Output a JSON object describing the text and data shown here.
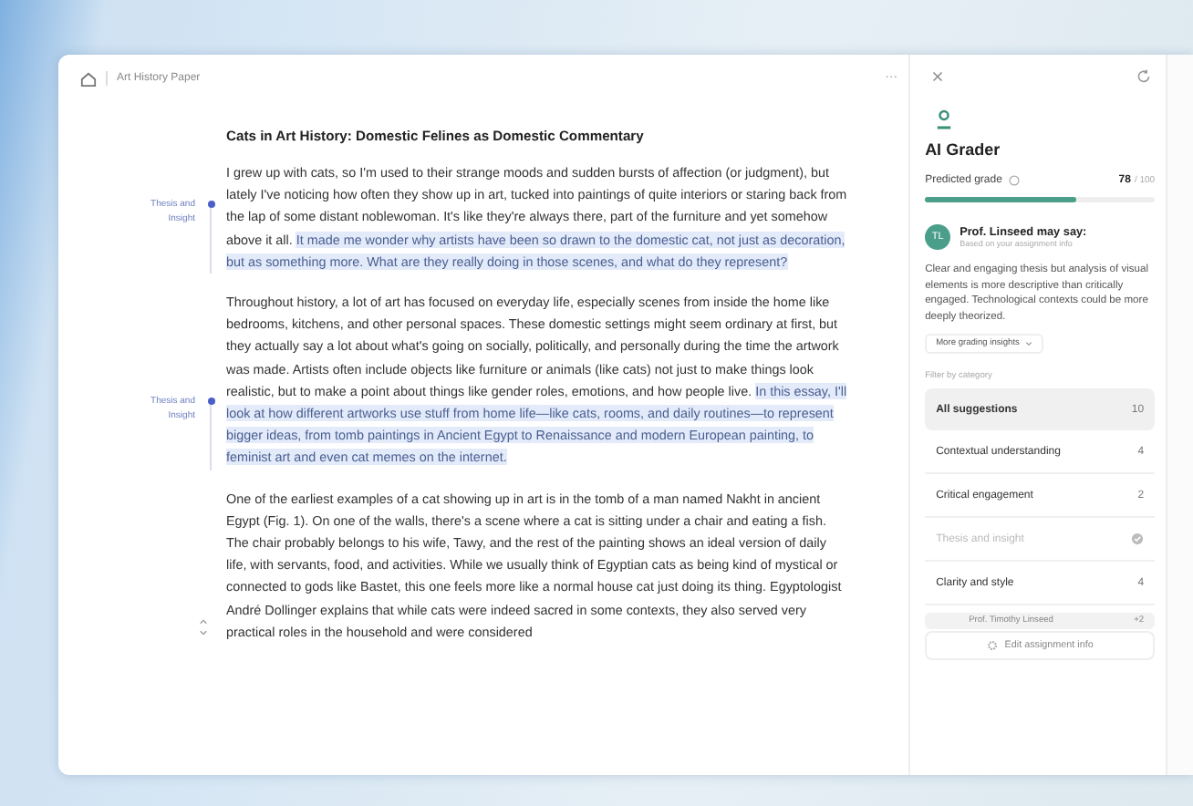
{
  "header": {
    "title": "Art History Paper",
    "more": "···"
  },
  "document": {
    "title": "Cats in Art History: Domestic Felines as Domestic Commentary",
    "paragraphs": [
      {
        "note": "Thesis and Insight",
        "segments": [
          {
            "text": "I grew up with cats, so I'm used to their strange moods and sudden bursts of affection (or judgment), but lately I've noticing how often they show up in art, tucked into paintings of quite interiors or staring back from the lap of some distant noblewoman. It's like they're always there, part of the furniture and yet somehow above it all. ",
            "highlighted": false
          },
          {
            "text": "It made me wonder why artists have been so drawn to the domestic cat, not just as decoration, but as something more. What are they really doing in those scenes, and what do they represent?",
            "highlighted": true
          }
        ]
      },
      {
        "note": "Thesis and Insight",
        "segments": [
          {
            "text": "Throughout history, a lot of art has focused on everyday life, especially scenes from inside the home like bedrooms, kitchens, and other personal spaces. These domestic settings might seem ordinary at first, but they actually say a lot about what's going on socially, politically, and personally during the time the artwork was made. Artists often include objects like furniture or animals (like cats) not just to make things look realistic, but to make a point about things like gender roles, emotions, and how people live. ",
            "highlighted": false
          },
          {
            "text": "In this essay, I'll look at how different artworks use stuff from home life—like cats, rooms, and daily routines—to represent bigger ideas, from tomb paintings in Ancient Egypt to Renaissance and modern European painting, to feminist art and even cat memes on the internet.",
            "highlighted": true
          }
        ]
      },
      {
        "segments": [
          {
            "text": "One of the earliest examples of a cat showing up in art is in the tomb of a man named Nakht in ancient Egypt (Fig. 1). On one of the walls, there's a scene where a cat is sitting under a chair and eating a fish. The chair probably belongs to his wife, Tawy, and the rest of the painting shows an ideal version of daily life, with servants, food, and activities. While we usually think of Egyptian cats as being kind of mystical or connected to gods like Bastet, this one feels more like a normal house cat just doing its thing. Egyptologist André Dollinger explains that while cats were indeed sacred in some contexts, they also served very practical roles in the household and were considered",
            "highlighted": false
          }
        ]
      }
    ]
  },
  "grader": {
    "title": "AI Grader",
    "grade_label": "Predicted grade",
    "grade": "78",
    "grade_max": "/ 100",
    "level": 0.66,
    "avatar": "TL",
    "reviewer": "Prof. Linseed may say:",
    "reviewer_sub": "Based on your assignment info",
    "feedback": "Clear and engaging thesis but analysis of visual elements is more descriptive than critically engaged. Technological contexts could be more deeply theorized.",
    "more_button": "More grading insights",
    "filter_label": "Filter by category",
    "categories": [
      {
        "label": "All suggestions",
        "count": "10",
        "selected": true,
        "done": false
      },
      {
        "label": "Contextual understanding",
        "count": "4",
        "selected": false,
        "done": false
      },
      {
        "label": "Critical engagement",
        "count": "2",
        "selected": false,
        "done": false
      },
      {
        "label": "Thesis and insight",
        "selected": false,
        "done": true
      },
      {
        "label": "Clarity and style",
        "count": "4",
        "selected": false,
        "done": false
      }
    ],
    "professor": "Prof. Timothy Linseed",
    "professor_extra": "+2",
    "edit_button": "Edit assignment info"
  }
}
